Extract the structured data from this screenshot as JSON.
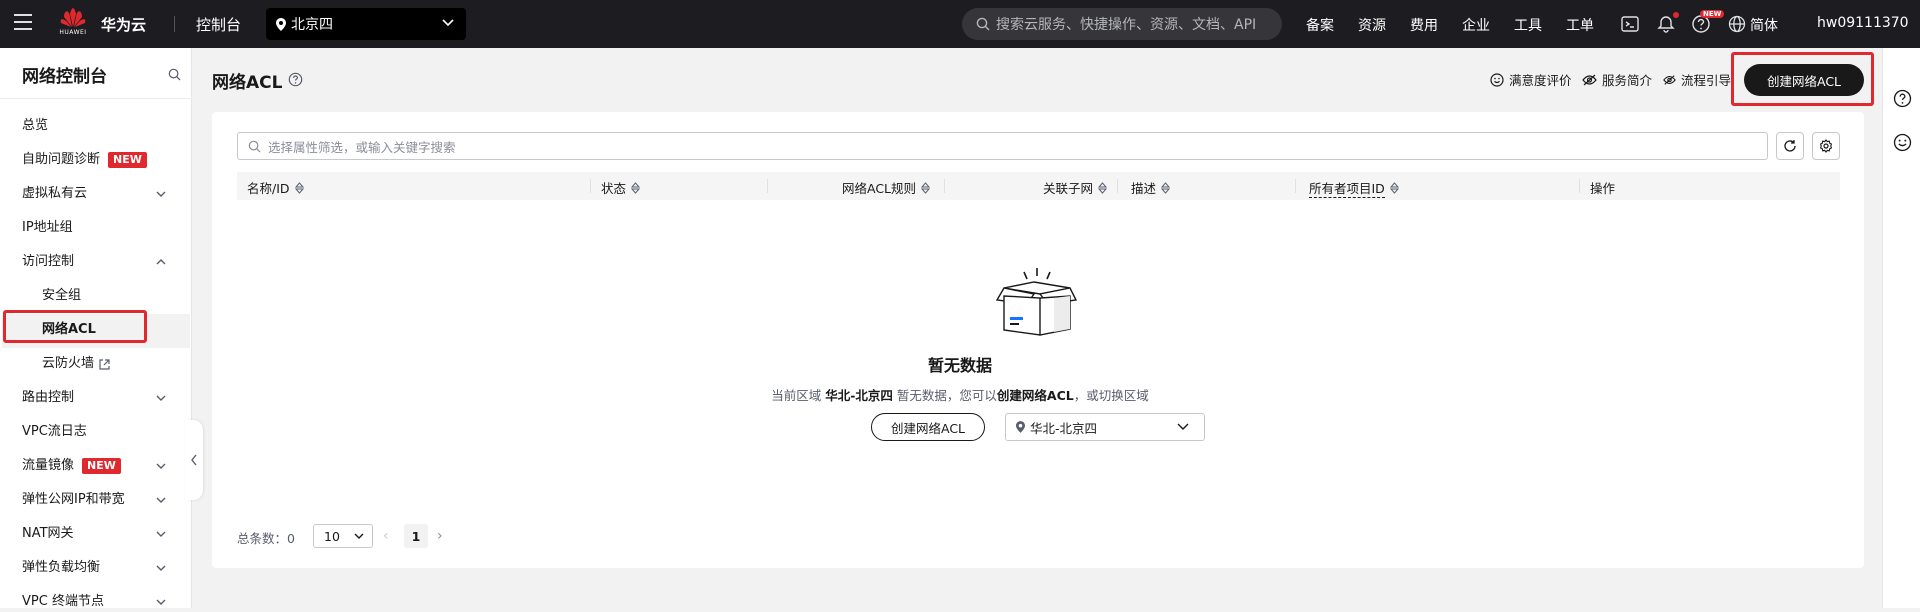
{
  "topbar": {
    "brand": "华为云",
    "logo_text": "HUAWEI",
    "console": "控制台",
    "region": "北京四",
    "search_placeholder": "搜索云服务、快捷操作、资源、文档、API",
    "nav": [
      "备案",
      "资源",
      "费用",
      "企业",
      "工具",
      "工单"
    ],
    "new_badge": "NEW",
    "language": "简体",
    "user": "hw09111370"
  },
  "sidebar": {
    "title": "网络控制台",
    "items": [
      {
        "label": "总览"
      },
      {
        "label": "自助问题诊断",
        "badge": "NEW"
      },
      {
        "label": "虚拟私有云"
      },
      {
        "label": "IP地址组"
      },
      {
        "label": "访问控制"
      },
      {
        "label": "安全组"
      },
      {
        "label": "网络ACL"
      },
      {
        "label": "云防火墙"
      },
      {
        "label": "路由控制"
      },
      {
        "label": "VPC流日志"
      },
      {
        "label": "流量镜像",
        "badge": "NEW"
      },
      {
        "label": "弹性公网IP和带宽"
      },
      {
        "label": "NAT网关"
      },
      {
        "label": "弹性负载均衡"
      },
      {
        "label": "VPC 终端节点"
      }
    ]
  },
  "header": {
    "title": "网络ACL",
    "links": [
      "满意度评价",
      "服务简介",
      "流程引导"
    ],
    "create_label": "创建网络ACL"
  },
  "filter": {
    "placeholder": "选择属性筛选，或输入关键字搜索"
  },
  "table": {
    "columns": [
      "名称/ID",
      "状态",
      "网络ACL规则",
      "关联子网",
      "描述",
      "所有者项目ID",
      "操作"
    ]
  },
  "empty": {
    "title": "暂无数据",
    "desc_prefix": "当前区域",
    "desc_region": "华北-北京四",
    "desc_middle": "暂无数据，您可以",
    "desc_action": "创建网络ACL",
    "desc_suffix": "，或切换区域",
    "create_label": "创建网络ACL",
    "region_select": "华北-北京四"
  },
  "pagination": {
    "total_label": "总条数：",
    "total": "0",
    "page_size": "10",
    "current_page": "1"
  },
  "colors": {
    "accent_red": "#e0292e",
    "topbar_bg": "#1d1d21",
    "primary_button": "#191919"
  }
}
